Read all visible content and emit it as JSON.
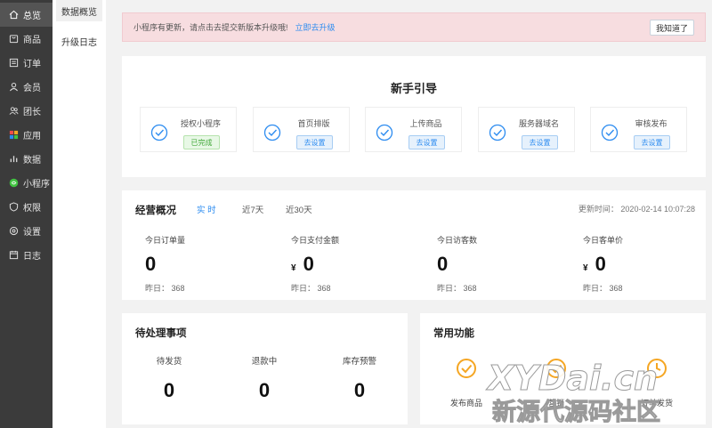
{
  "sidebar": {
    "items": [
      {
        "label": "总览",
        "icon": "home-icon",
        "active": true
      },
      {
        "label": "商品",
        "icon": "shopping-bag-icon"
      },
      {
        "label": "订单",
        "icon": "order-list-icon"
      },
      {
        "label": "会员",
        "icon": "user-icon"
      },
      {
        "label": "团长",
        "icon": "users-icon"
      },
      {
        "label": "应用",
        "icon": "apps-grid-icon"
      },
      {
        "label": "数据",
        "icon": "bar-chart-icon"
      },
      {
        "label": "小程序",
        "icon": "mini-program-icon"
      },
      {
        "label": "权限",
        "icon": "shield-icon"
      },
      {
        "label": "设置",
        "icon": "gear-icon"
      },
      {
        "label": "日志",
        "icon": "calendar-icon"
      }
    ]
  },
  "subnav": {
    "items": [
      {
        "label": "数据概览",
        "active": true
      },
      {
        "label": "升级日志"
      }
    ]
  },
  "notice": {
    "text": "小程序有更新，请点击去提交新版本升级哦!",
    "link": "立即去升级",
    "ack": "我知道了"
  },
  "guide": {
    "title": "新手引导",
    "steps": [
      {
        "label": "授权小程序",
        "button": "已完成",
        "status": "done"
      },
      {
        "label": "首页排版",
        "button": "去设置",
        "status": "todo"
      },
      {
        "label": "上传商品",
        "button": "去设置",
        "status": "todo"
      },
      {
        "label": "服务器域名",
        "button": "去设置",
        "status": "todo"
      },
      {
        "label": "审核发布",
        "button": "去设置",
        "status": "todo"
      }
    ]
  },
  "business": {
    "title": "经营概况",
    "tabs": [
      "实 时",
      "近7天",
      "近30天"
    ],
    "update_time": "更新时间： 2020-02-14 10:07:28",
    "currency": "¥",
    "metrics": [
      {
        "label": "今日订单量",
        "value": "0",
        "yesterday": "昨日： 368",
        "currency": false
      },
      {
        "label": "今日支付金额",
        "value": "0",
        "yesterday": "昨日： 368",
        "currency": true
      },
      {
        "label": "今日访客数",
        "value": "0",
        "yesterday": "昨日： 368",
        "currency": false
      },
      {
        "label": "今日客单价",
        "value": "0",
        "yesterday": "昨日： 368",
        "currency": true
      }
    ]
  },
  "pending": {
    "title": "待处理事项",
    "items": [
      {
        "label": "待发货",
        "value": "0"
      },
      {
        "label": "退款中",
        "value": "0"
      },
      {
        "label": "库存预警",
        "value": "0"
      }
    ]
  },
  "common": {
    "title": "常用功能",
    "items": [
      {
        "label": "发布商品"
      },
      {
        "label": "营销"
      },
      {
        "label": "订单发货"
      }
    ]
  },
  "watermark": {
    "line1": "XYDai.cn",
    "line2": "新源代源码社区"
  },
  "colors": {
    "accent": "#2d8cf0",
    "success": "#41a839",
    "orange": "#f5a623",
    "sidebar_bg": "#3b3b3b"
  }
}
